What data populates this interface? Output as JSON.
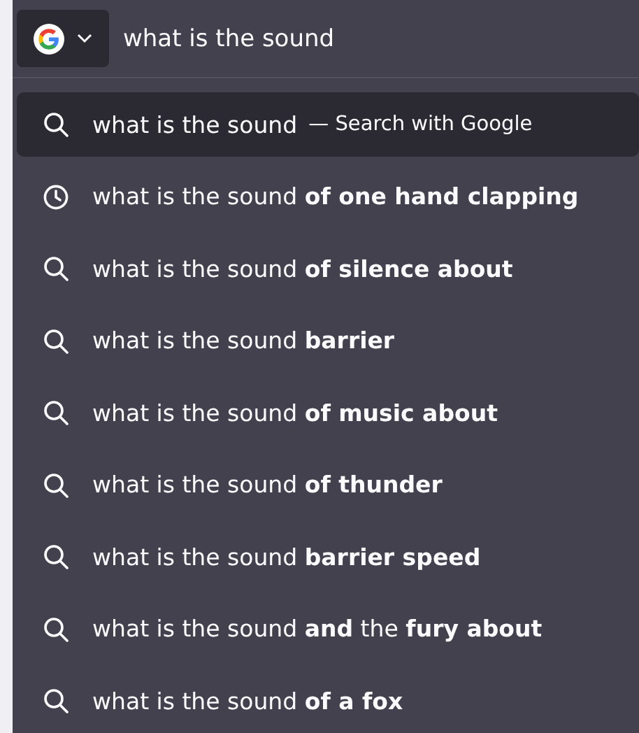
{
  "search_bar": {
    "value": "what is the sound"
  },
  "suggestions": [
    {
      "kind": "search",
      "text": "what is the sound",
      "suffix": "— Search with Google",
      "selected": true
    },
    {
      "kind": "history",
      "text": "what is the sound **of one hand clapping**",
      "selected": false
    },
    {
      "kind": "search",
      "text": "what is the sound **of silence about**",
      "selected": false
    },
    {
      "kind": "search",
      "text": "what is the sound **barrier**",
      "selected": false
    },
    {
      "kind": "search",
      "text": "what is the sound **of music about**",
      "selected": false
    },
    {
      "kind": "search",
      "text": "what is the sound **of thunder**",
      "selected": false
    },
    {
      "kind": "search",
      "text": "what is the sound **barrier speed**",
      "selected": false
    },
    {
      "kind": "search",
      "text": "what is the sound **and** the **fury about**",
      "selected": false
    },
    {
      "kind": "search",
      "text": "what is the sound **of a fox**",
      "selected": false
    }
  ]
}
